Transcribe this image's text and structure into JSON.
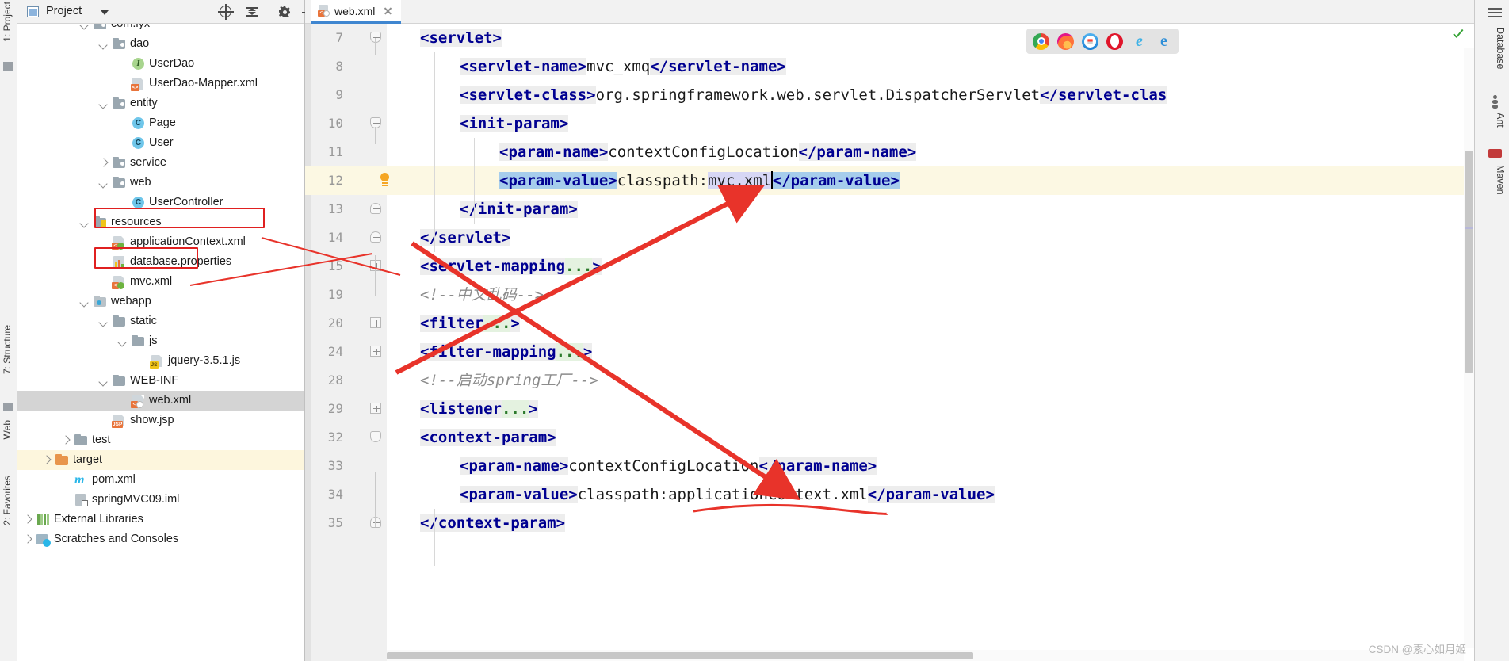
{
  "window": {
    "left_strips": [
      {
        "label": "1: Project",
        "name": "tool-window-project"
      },
      {
        "label": "7: Structure",
        "name": "tool-window-structure"
      },
      {
        "label": "2: Favorites",
        "name": "tool-window-favorites"
      },
      {
        "label": "Web",
        "name": "tool-window-web"
      }
    ],
    "right_strips": [
      {
        "label": "Database",
        "name": "tool-window-database"
      },
      {
        "label": "Ant",
        "name": "tool-window-ant"
      },
      {
        "label": "Maven",
        "name": "tool-window-maven"
      }
    ]
  },
  "project_panel": {
    "title": "Project",
    "buttons": [
      {
        "name": "locate-in-tree-button",
        "icon": "target-icon"
      },
      {
        "name": "collapse-all-button",
        "icon": "collapse-all-icon"
      },
      {
        "name": "settings-button",
        "icon": "gear-icon"
      },
      {
        "name": "hide-button",
        "icon": "minimize-icon"
      }
    ],
    "tree": [
      {
        "label": "com.lyx",
        "indent": 4,
        "icon": "package-folder-icon",
        "twisty": "down",
        "row": "normal"
      },
      {
        "label": "dao",
        "indent": 5,
        "icon": "package-folder-icon",
        "twisty": "down",
        "row": "normal"
      },
      {
        "label": "UserDao",
        "indent": 6,
        "icon": "interface-icon",
        "twisty": "none",
        "row": "normal"
      },
      {
        "label": "UserDao-Mapper.xml",
        "indent": 6,
        "icon": "xml-file-icon",
        "twisty": "none",
        "row": "normal"
      },
      {
        "label": "entity",
        "indent": 5,
        "icon": "package-folder-icon",
        "twisty": "down",
        "row": "normal"
      },
      {
        "label": "Page",
        "indent": 6,
        "icon": "class-icon",
        "twisty": "none",
        "row": "normal"
      },
      {
        "label": "User",
        "indent": 6,
        "icon": "class-icon",
        "twisty": "none",
        "row": "normal"
      },
      {
        "label": "service",
        "indent": 5,
        "icon": "package-folder-icon",
        "twisty": "right",
        "row": "normal"
      },
      {
        "label": "web",
        "indent": 5,
        "icon": "package-folder-icon",
        "twisty": "down",
        "row": "normal"
      },
      {
        "label": "UserController",
        "indent": 6,
        "icon": "class-icon",
        "twisty": "none",
        "row": "normal"
      },
      {
        "label": "resources",
        "indent": 4,
        "icon": "resources-folder-icon",
        "twisty": "down",
        "row": "normal"
      },
      {
        "label": "applicationContext.xml",
        "indent": 5,
        "icon": "spring-xml-icon",
        "twisty": "none",
        "row": "normal"
      },
      {
        "label": "database.properties",
        "indent": 5,
        "icon": "properties-icon",
        "twisty": "none",
        "row": "normal"
      },
      {
        "label": "mvc.xml",
        "indent": 5,
        "icon": "spring-xml-icon",
        "twisty": "none",
        "row": "normal"
      },
      {
        "label": "webapp",
        "indent": 4,
        "icon": "webapp-icon",
        "twisty": "down",
        "row": "normal"
      },
      {
        "label": "static",
        "indent": 5,
        "icon": "plain-folder-icon",
        "twisty": "down",
        "row": "normal"
      },
      {
        "label": "js",
        "indent": 6,
        "icon": "plain-folder-icon",
        "twisty": "down",
        "row": "normal"
      },
      {
        "label": "jquery-3.5.1.js",
        "indent": 7,
        "icon": "js-file-icon",
        "twisty": "none",
        "row": "normal"
      },
      {
        "label": "WEB-INF",
        "indent": 5,
        "icon": "plain-folder-icon",
        "twisty": "down",
        "row": "normal"
      },
      {
        "label": "web.xml",
        "indent": 6,
        "icon": "web-xml-icon",
        "twisty": "none",
        "row": "selected"
      },
      {
        "label": "show.jsp",
        "indent": 5,
        "icon": "jsp-file-icon",
        "twisty": "none",
        "row": "normal"
      },
      {
        "label": "test",
        "indent": 3,
        "icon": "plain-folder-icon",
        "twisty": "right",
        "row": "normal"
      },
      {
        "label": "target",
        "indent": 2,
        "icon": "target-folder-icon",
        "twisty": "right",
        "row": "highlighted"
      },
      {
        "label": "pom.xml",
        "indent": 3,
        "icon": "maven-icon",
        "twisty": "none",
        "row": "normal"
      },
      {
        "label": "springMVC09.iml",
        "indent": 3,
        "icon": "iml-file-icon",
        "twisty": "none",
        "row": "normal"
      },
      {
        "label": "External Libraries",
        "indent": 1,
        "icon": "libraries-icon",
        "twisty": "right",
        "row": "normal"
      },
      {
        "label": "Scratches and Consoles",
        "indent": 1,
        "icon": "scratches-icon",
        "twisty": "right",
        "row": "normal"
      }
    ],
    "annotations": [
      {
        "name": "redbox-applicationContext",
        "target": "applicationContext.xml"
      },
      {
        "name": "redbox-mvc-xml",
        "target": "mvc.xml"
      }
    ]
  },
  "editor": {
    "tab": {
      "label": "web.xml",
      "icon": "web-xml-icon",
      "close": "close-icon"
    },
    "status_icon": "inspection-ok-check-icon",
    "lines": [
      {
        "num": "7",
        "fold": "minus-round-top",
        "segments": [
          {
            "t": "<",
            "c": "tagname",
            "bg": "tag"
          },
          {
            "t": "servlet",
            "c": "tagname",
            "bg": "tag"
          },
          {
            "t": ">",
            "c": "tagname",
            "bg": "tag"
          }
        ],
        "indent": 0
      },
      {
        "num": "8",
        "fold": "none",
        "segments": [
          {
            "t": "<servlet-name>",
            "c": "tagname",
            "bg": "tag"
          },
          {
            "t": "mvc_xmq",
            "c": "plain",
            "bg": "none"
          },
          {
            "t": "</servlet-name>",
            "c": "tagname",
            "bg": "tag"
          }
        ],
        "indent": 1
      },
      {
        "num": "9",
        "fold": "none",
        "segments": [
          {
            "t": "<servlet-class>",
            "c": "tagname",
            "bg": "tag"
          },
          {
            "t": "org.springframework.web.servlet.DispatcherServlet",
            "c": "plain",
            "bg": "none"
          },
          {
            "t": "</servlet-clas",
            "c": "tagname",
            "bg": "tag"
          }
        ],
        "indent": 1
      },
      {
        "num": "10",
        "fold": "minus-round-top",
        "segments": [
          {
            "t": "<init-param>",
            "c": "tagname",
            "bg": "tag"
          }
        ],
        "indent": 1
      },
      {
        "num": "11",
        "fold": "none",
        "segments": [
          {
            "t": "<param-name>",
            "c": "tagname",
            "bg": "tag"
          },
          {
            "t": "contextConfigLocation",
            "c": "plain",
            "bg": "none"
          },
          {
            "t": "</param-name>",
            "c": "tagname",
            "bg": "tag"
          }
        ],
        "indent": 2
      },
      {
        "num": "12",
        "fold": "bulb",
        "current": true,
        "segments": [
          {
            "t": "<param-value>",
            "c": "tagname",
            "bg": "sel"
          },
          {
            "t": "classpath:",
            "c": "plain",
            "bg": "none"
          },
          {
            "t": "mvc.xml",
            "c": "plain",
            "bg": "occ"
          },
          {
            "t": "|",
            "c": "caret",
            "bg": "none"
          },
          {
            "t": "</param-value>",
            "c": "tagname",
            "bg": "sel"
          }
        ],
        "indent": 2
      },
      {
        "num": "13",
        "fold": "minus-round-bottom",
        "segments": [
          {
            "t": "</init-param>",
            "c": "tagname",
            "bg": "tag"
          }
        ],
        "indent": 1
      },
      {
        "num": "14",
        "fold": "minus-round-bottom",
        "segments": [
          {
            "t": "</servlet>",
            "c": "tagname",
            "bg": "tag"
          }
        ],
        "indent": 0
      },
      {
        "num": "15",
        "fold": "plus",
        "segments": [
          {
            "t": "<servlet-mapping",
            "c": "tagname",
            "bg": "tag"
          },
          {
            "t": "...",
            "c": "ellipsis",
            "bg": "fold"
          },
          {
            "t": ">",
            "c": "tagname",
            "bg": "tag"
          }
        ],
        "indent": 0
      },
      {
        "num": "19",
        "fold": "none",
        "segments": [
          {
            "t": "<!--中文乱码-->",
            "c": "comment",
            "bg": "none"
          }
        ],
        "indent": 0
      },
      {
        "num": "20",
        "fold": "plus",
        "segments": [
          {
            "t": "<filter",
            "c": "tagname",
            "bg": "tag"
          },
          {
            "t": "...",
            "c": "ellipsis",
            "bg": "fold"
          },
          {
            "t": ">",
            "c": "tagname",
            "bg": "tag"
          }
        ],
        "indent": 0
      },
      {
        "num": "24",
        "fold": "plus",
        "segments": [
          {
            "t": "<filter-mapping",
            "c": "tagname",
            "bg": "tag"
          },
          {
            "t": "...",
            "c": "ellipsis",
            "bg": "fold"
          },
          {
            "t": ">",
            "c": "tagname",
            "bg": "tag"
          }
        ],
        "indent": 0
      },
      {
        "num": "28",
        "fold": "none",
        "segments": [
          {
            "t": "<!--启动spring工厂-->",
            "c": "comment",
            "bg": "none"
          }
        ],
        "indent": 0
      },
      {
        "num": "29",
        "fold": "plus",
        "segments": [
          {
            "t": "<listener",
            "c": "tagname",
            "bg": "tag"
          },
          {
            "t": "...",
            "c": "ellipsis",
            "bg": "fold"
          },
          {
            "t": ">",
            "c": "tagname",
            "bg": "tag"
          }
        ],
        "indent": 0
      },
      {
        "num": "32",
        "fold": "minus-round-top",
        "segments": [
          {
            "t": "<context-param>",
            "c": "tagname",
            "bg": "tag"
          }
        ],
        "indent": 0
      },
      {
        "num": "33",
        "fold": "none",
        "segments": [
          {
            "t": "<param-name>",
            "c": "tagname",
            "bg": "tag"
          },
          {
            "t": "contextConfigLocation",
            "c": "plain",
            "bg": "none"
          },
          {
            "t": "</param-name>",
            "c": "tagname",
            "bg": "tag"
          }
        ],
        "indent": 1
      },
      {
        "num": "34",
        "fold": "none",
        "segments": [
          {
            "t": "<param-value>",
            "c": "tagname",
            "bg": "tag"
          },
          {
            "t": "classpath:applicationContext.xml",
            "c": "plain",
            "bg": "none"
          },
          {
            "t": "</param-value>",
            "c": "tagname",
            "bg": "tag"
          }
        ],
        "indent": 1
      },
      {
        "num": "35",
        "fold": "minus-round-bottom",
        "segments": [
          {
            "t": "</context-param>",
            "c": "tagname",
            "bg": "tag"
          }
        ],
        "indent": 0
      }
    ]
  },
  "browser_bar": {
    "name": "open-in-browser-popup",
    "browsers": [
      {
        "name": "chrome-icon",
        "label": "Chrome"
      },
      {
        "name": "firefox-icon",
        "label": "Firefox"
      },
      {
        "name": "safari-icon",
        "label": "Safari"
      },
      {
        "name": "opera-icon",
        "label": "Opera"
      },
      {
        "name": "ie-icon",
        "label": "Internet Explorer"
      },
      {
        "name": "edge-icon",
        "label": "Edge"
      }
    ]
  },
  "annotations": {
    "arrows": [
      {
        "name": "arrow-mvc-to-param-value",
        "color": "#e8332a"
      },
      {
        "name": "arrow-appcontext-to-line34",
        "color": "#e8332a"
      },
      {
        "name": "underline-applicationContext-line34",
        "color": "#e8332a"
      }
    ]
  },
  "watermark": "CSDN @素心如月姬",
  "colors": {
    "accent": "#3f86d0",
    "annotation_red": "#e8332a",
    "tag_blue": "#000091",
    "selection": "#a6cdec",
    "occurrence": "#d7d7f5",
    "current_line": "#fcf8e3"
  }
}
